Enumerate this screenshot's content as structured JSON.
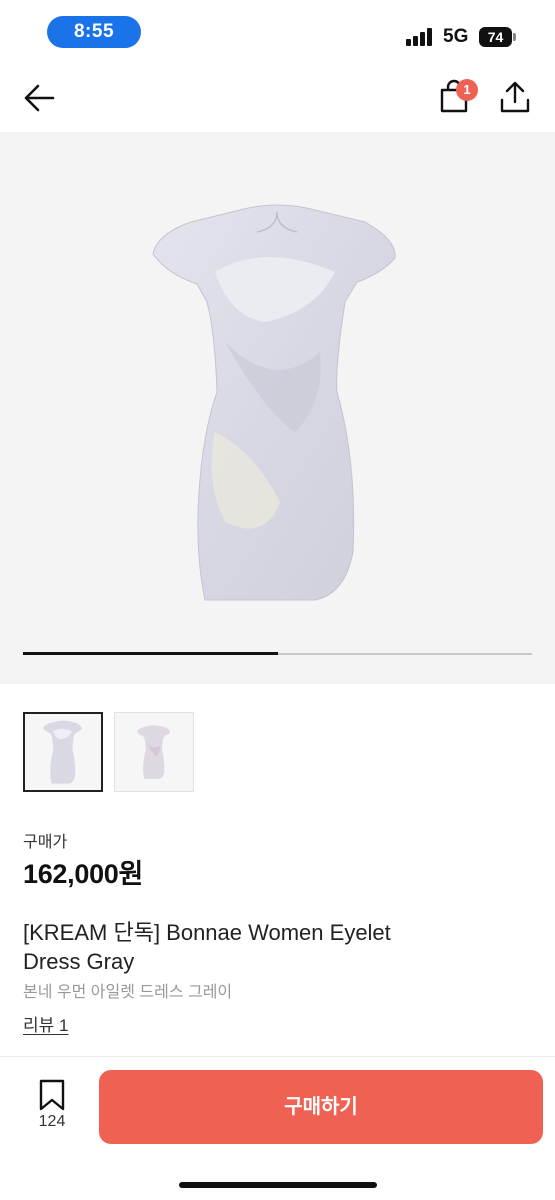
{
  "status_bar": {
    "time": "8:55",
    "network": "5G",
    "battery": "74"
  },
  "header": {
    "back_icon": "arrow-left-icon",
    "cart_icon": "shopping-bag-icon",
    "cart_badge": "1",
    "share_icon": "share-upload-icon"
  },
  "gallery": {
    "image_count": 2,
    "current_index": 1,
    "progress": 0.5
  },
  "product": {
    "price_label": "구매가",
    "price": "162,000원",
    "title": "[KREAM 단독] Bonnae Women Eyelet Dress Gray",
    "subtitle": "본네 우먼 아일렛 드레스 그레이",
    "review_link": "리뷰 1"
  },
  "bottom_bar": {
    "wishlist_icon": "bookmark-icon",
    "wishlist_count": "124",
    "buy_label": "구매하기"
  },
  "colors": {
    "accent": "#ef6253",
    "time_pill": "#1a73e8",
    "gallery_bg": "#f4f4f4"
  }
}
